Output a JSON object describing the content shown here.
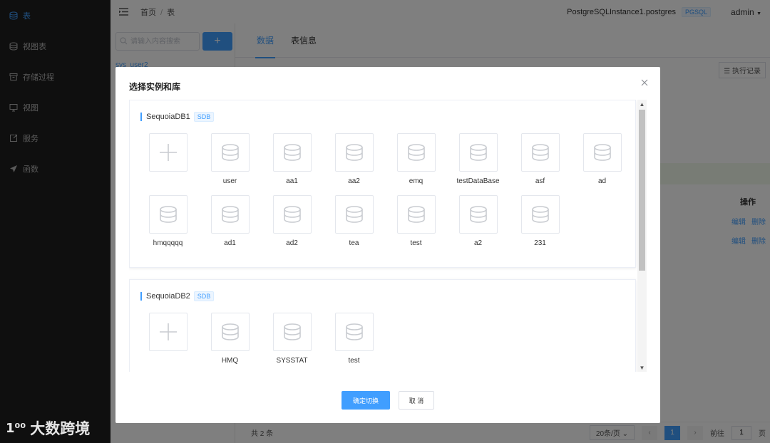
{
  "sidebar": {
    "items": [
      {
        "label": "表",
        "icon": "database-icon",
        "active": true
      },
      {
        "label": "视图表",
        "icon": "database-icon"
      },
      {
        "label": "存储过程",
        "icon": "archive-icon"
      },
      {
        "label": "视图",
        "icon": "monitor-icon"
      },
      {
        "label": "服务",
        "icon": "export-icon"
      },
      {
        "label": "函数",
        "icon": "send-icon"
      }
    ],
    "watermark": "大数跨境",
    "watermark_logo": "1⁰⁰"
  },
  "header": {
    "breadcrumb": [
      "首页",
      "表"
    ],
    "instance": "PostgreSQLInstance1.postgres",
    "badge": "PGSQL",
    "user": "admin"
  },
  "left_panel": {
    "search_placeholder": "请输入内容搜索",
    "add_label": "+",
    "tree_item": "sys_user2"
  },
  "main": {
    "tabs": [
      "数据",
      "表信息"
    ],
    "exec_label": "执行记录",
    "ops_header": "操作",
    "row_actions": [
      "编辑",
      "删除"
    ],
    "total": "共 2 条",
    "page_size": "20条/页",
    "current_page": "1",
    "goto_label": "前往",
    "goto_value": "1",
    "page_unit": "页"
  },
  "dialog": {
    "title": "选择实例和库",
    "groups": [
      {
        "name": "SequoiaDB1",
        "badge": "SDB",
        "databases": [
          "user",
          "aa1",
          "aa2",
          "emq",
          "testDataBase",
          "asf",
          "ad",
          "hmqqqqq",
          "ad1",
          "ad2",
          "tea",
          "test",
          "a2",
          "231"
        ]
      },
      {
        "name": "SequoiaDB2",
        "badge": "SDB",
        "databases": [
          "HMQ",
          "SYSSTAT",
          "test"
        ]
      }
    ],
    "confirm_label": "确定切换",
    "cancel_label": "取 消"
  },
  "colors": {
    "accent": "#409eff",
    "sidebar_bg": "#1f1f1f"
  }
}
